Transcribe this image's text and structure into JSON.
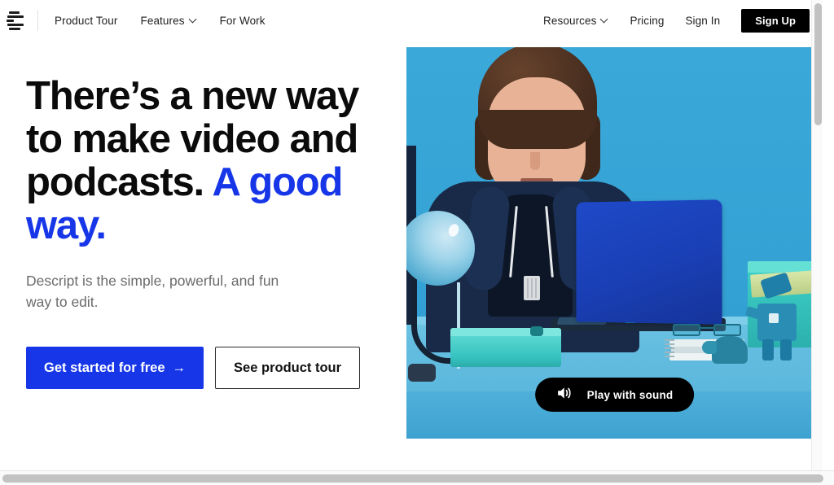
{
  "brand": {
    "logo_name": "descript-logo",
    "accent_blue": "#1736e8",
    "video_bg_blue": "#38a6d6",
    "black": "#000000"
  },
  "nav": {
    "left_links": [
      {
        "label": "Product Tour",
        "has_dropdown": false
      },
      {
        "label": "Features",
        "has_dropdown": true
      },
      {
        "label": "For Work",
        "has_dropdown": false
      }
    ],
    "right_links": [
      {
        "label": "Resources",
        "has_dropdown": true
      },
      {
        "label": "Pricing",
        "has_dropdown": false
      },
      {
        "label": "Sign In",
        "has_dropdown": false
      }
    ],
    "signup_label": "Sign Up"
  },
  "hero": {
    "headline_plain": "There’s a new way to make video and podcasts. ",
    "headline_accent": "A good way.",
    "subhead": "Descript is the simple, powerful, and fun way to edit.",
    "primary_cta": "Get started for free",
    "primary_cta_arrow": "→",
    "secondary_cta": "See product tour"
  },
  "video": {
    "overlay_button_label": "Play with sound",
    "overlay_icon": "speaker-sound-icon",
    "scene_description": "Man with bowl haircut in navy hoodie typing on a blue laptop at a light-blue desk"
  }
}
